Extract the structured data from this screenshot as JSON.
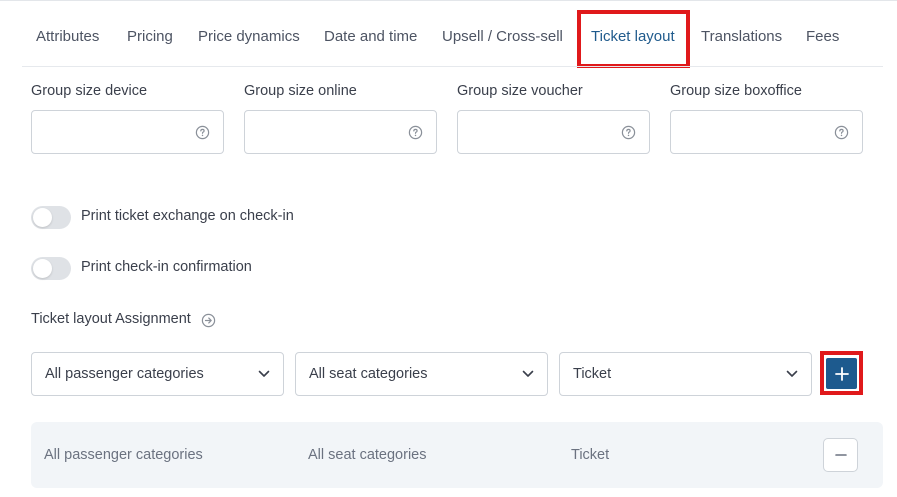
{
  "tabs": [
    {
      "label": "Attributes",
      "active": false
    },
    {
      "label": "Pricing",
      "active": false
    },
    {
      "label": "Price dynamics",
      "active": false
    },
    {
      "label": "Date and time",
      "active": false
    },
    {
      "label": "Upsell / Cross-sell",
      "active": false
    },
    {
      "label": "Ticket layout",
      "active": true
    },
    {
      "label": "Translations",
      "active": false
    },
    {
      "label": "Fees",
      "active": false
    }
  ],
  "group_size": {
    "fields": [
      {
        "label": "Group size device",
        "value": "",
        "icon": "help-circle-icon"
      },
      {
        "label": "Group size online",
        "value": "",
        "icon": "help-circle-icon"
      },
      {
        "label": "Group size voucher",
        "value": "",
        "icon": "help-circle-icon"
      },
      {
        "label": "Group size boxoffice",
        "value": "",
        "icon": "help-circle-icon"
      }
    ]
  },
  "toggles": [
    {
      "label": "Print ticket exchange on check-in",
      "enabled": false
    },
    {
      "label": "Print check-in confirmation",
      "enabled": false
    }
  ],
  "assignment": {
    "title": "Ticket layout Assignment",
    "title_icon": "circle-arrow-right-icon",
    "selects": [
      {
        "value": "All passenger categories"
      },
      {
        "value": "All seat categories"
      },
      {
        "value": "Ticket"
      }
    ],
    "add_button_icon": "plus-icon",
    "rows": [
      {
        "passenger": "All passenger categories",
        "seat": "All seat categories",
        "layout": "Ticket",
        "remove_icon": "minus-icon"
      }
    ]
  },
  "colors": {
    "accent": "#1d5a8e",
    "active_tab": "#1f5a8c",
    "highlight": "#e0191b",
    "row_background": "#f2f5f8"
  }
}
